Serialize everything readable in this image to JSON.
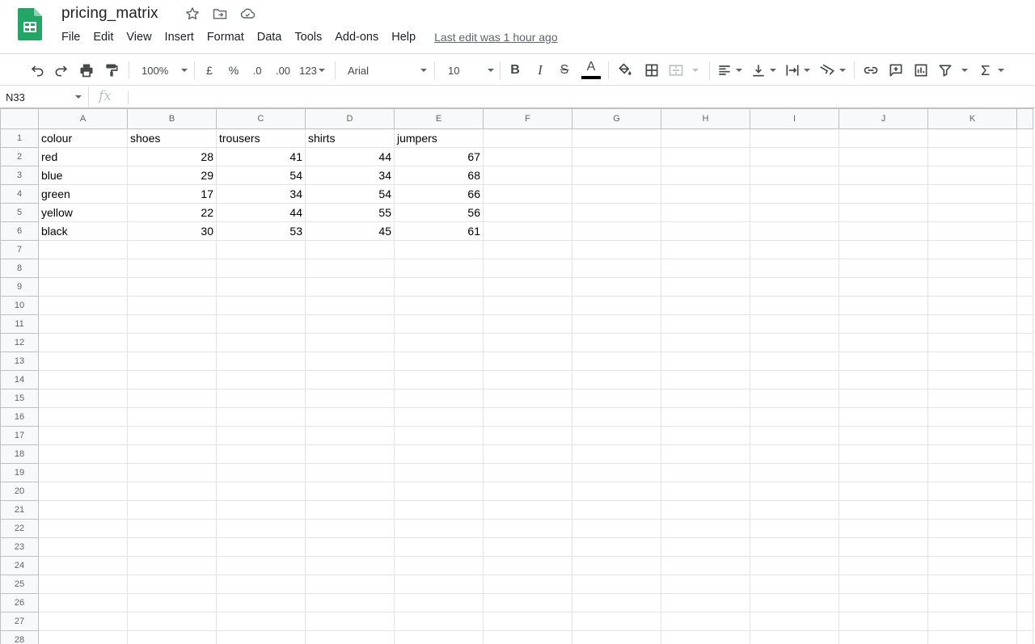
{
  "app": {
    "title": "pricing_matrix",
    "menu": [
      "File",
      "Edit",
      "View",
      "Insert",
      "Format",
      "Data",
      "Tools",
      "Add-ons",
      "Help"
    ],
    "last_edit": "Last edit was 1 hour ago"
  },
  "toolbar": {
    "zoom": "100%",
    "currency": "£",
    "percent": "%",
    "decrease_decimal": ".0",
    "increase_decimal": ".00",
    "number_format": "123",
    "font": "Arial",
    "font_size": "10",
    "bold": "B",
    "italic": "I",
    "strike": "S",
    "text_color_letter": "A",
    "text_color": "#000000"
  },
  "formula_bar": {
    "cell_ref": "N33",
    "fx": "fx",
    "value": ""
  },
  "sheet": {
    "columns": [
      "A",
      "B",
      "C",
      "D",
      "E",
      "F",
      "G",
      "H",
      "I",
      "J",
      "K"
    ],
    "rows": [
      [
        "colour",
        "shoes",
        "trousers",
        "shirts",
        "jumpers"
      ],
      [
        "red",
        "28",
        "41",
        "44",
        "67"
      ],
      [
        "blue",
        "29",
        "54",
        "34",
        "68"
      ],
      [
        "green",
        "17",
        "34",
        "54",
        "66"
      ],
      [
        "yellow",
        "22",
        "44",
        "55",
        "56"
      ],
      [
        "black",
        "30",
        "53",
        "45",
        "61"
      ]
    ],
    "row_count": 28
  },
  "colors": {
    "sheets_green": "#0f9d58",
    "grid_line": "#e2e3e3",
    "header_bg": "#f8f9fa"
  },
  "icons": {
    "logo": "google-sheets-logo",
    "star": "star-icon",
    "move": "folder-move-icon",
    "cloud": "cloud-saved-icon"
  }
}
